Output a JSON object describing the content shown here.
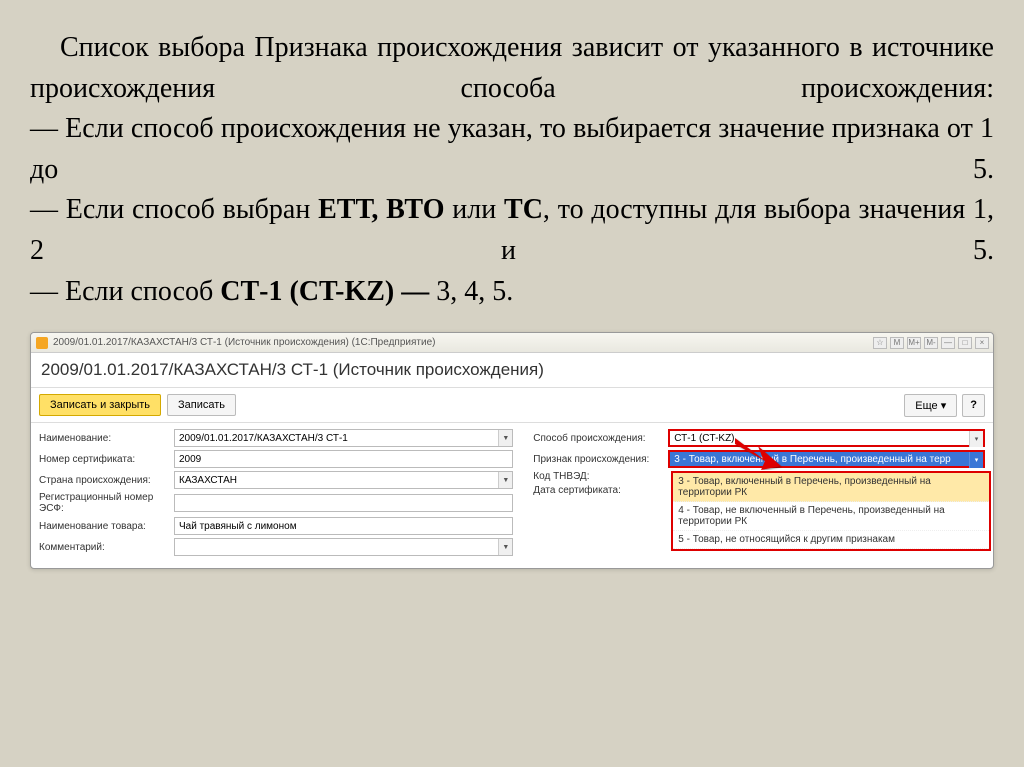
{
  "description": {
    "line1": "Список выбора Признака происхождения зависит от указанного в источнике происхождения способа происхождения:",
    "line2_pre": "— Если способ происхождения не указан, то выбирается значение признака от 1 до 5.",
    "line3_pre": "— Если способ выбран ",
    "line3_b1": "ЕТТ, ВТО",
    "line3_mid": " или ",
    "line3_b2": "ТС",
    "line3_post": ", то доступны для выбора значения 1, 2 и 5.",
    "line4_pre": "— Если способ ",
    "line4_b": "СТ-1 (CT-KZ) —",
    "line4_post": " 3, 4, 5."
  },
  "titlebar": {
    "text": "2009/01.01.2017/КАЗАХСТАН/3 СТ-1 (Источник происхождения)   (1С:Предприятие)"
  },
  "main_title": "2009/01.01.2017/КАЗАХСТАН/3 СТ-1 (Источник происхождения)",
  "toolbar": {
    "save_close": "Записать и закрыть",
    "save": "Записать",
    "more": "Еще",
    "help": "?"
  },
  "left": {
    "name_label": "Наименование:",
    "name_value": "2009/01.01.2017/КАЗАХСТАН/3 СТ-1",
    "cert_label": "Номер сертификата:",
    "cert_value": "2009",
    "country_label": "Страна происхождения:",
    "country_value": "КАЗАХСТАН",
    "reg_label": "Регистрационный номер ЭСФ:",
    "reg_value": "",
    "goods_label": "Наименование товара:",
    "goods_value": "Чай травяный с лимоном",
    "comment_label": "Комментарий:",
    "comment_value": ""
  },
  "right": {
    "method_label": "Способ происхождения:",
    "method_value": "СТ-1 (CT-KZ)",
    "sign_label": "Признак происхождения:",
    "sign_value": "3 - Товар, включенный в Перечень, произведенный на терр",
    "tnved_label": "Код ТНВЭД:",
    "tnved_value": "",
    "date_label": "Дата сертификата:",
    "date_value": ""
  },
  "dropdown": {
    "opt1": "3 - Товар, включенный в Перечень, произведенный на территории РК",
    "opt2": "4 - Товар, не включенный в Перечень, произведенный на территории РК",
    "opt3": "5 - Товар, не относящийся к другим признакам"
  }
}
